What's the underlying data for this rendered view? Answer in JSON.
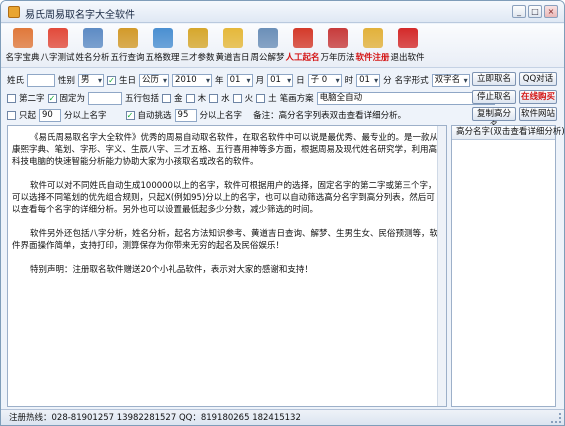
{
  "window": {
    "title": "易氏周易取名字大全软件"
  },
  "toolbar": [
    {
      "label": "名字宝典",
      "icon": "gift-icon",
      "color": "#e0783a"
    },
    {
      "label": "八字测试",
      "icon": "lifebuoy-icon",
      "color": "#e24a3a"
    },
    {
      "label": "姓名分析",
      "icon": "clipboard-icon",
      "color": "#5d8bc4"
    },
    {
      "label": "五行查询",
      "icon": "magnifier-icon",
      "color": "#d29a2a"
    },
    {
      "label": "五格数理",
      "icon": "chart-icon",
      "color": "#4a8fd1"
    },
    {
      "label": "三才参数",
      "icon": "bars-icon",
      "color": "#d6a72c"
    },
    {
      "label": "黄道吉日",
      "icon": "clock-icon",
      "color": "#e5b83a"
    },
    {
      "label": "周公解梦",
      "icon": "monitor-icon",
      "color": "#6b8fb8"
    },
    {
      "label": "人工起名",
      "icon": "house-icon",
      "color": "#d43a2a",
      "red": true
    },
    {
      "label": "万年历法",
      "icon": "flag-icon",
      "color": "#c73b3b"
    },
    {
      "label": "软件注册",
      "icon": "lock-icon",
      "color": "#e2b13a",
      "red": true
    },
    {
      "label": "退出软件",
      "icon": "stop-icon",
      "color": "#d42a2a"
    }
  ],
  "form": {
    "surname_label": "姓氏",
    "gender_label": "性别",
    "gender_value": "男",
    "birthday_label": "生日",
    "calendar_value": "公历",
    "year_value": "2010",
    "year_unit": "年",
    "month_value": "01",
    "month_unit": "月",
    "day_value": "01",
    "day_unit": "日",
    "hour_prefix": "子 0",
    "hour_unit": "时",
    "hour_value": "01",
    "minute_unit": "分",
    "name_form_label": "名字形式",
    "name_form_value": "双字名",
    "fixed_char_label": "第二字",
    "fixed_label": "固定为",
    "wuxing_label": "五行包括",
    "wuxing_options": [
      "金",
      "木",
      "水",
      "火",
      "土"
    ],
    "scheme_label": "笔画方案",
    "scheme_value": "电脑全自动",
    "only_label": "只起",
    "only_value": "90",
    "above_label": "分以上名字",
    "autoselect_label": "自动挑选",
    "autoselect_value": "95",
    "autoselect_suffix": "分以上名字",
    "note": "备注：高分名字列表双击查看详细分析。"
  },
  "buttons": {
    "start": "立即取名",
    "qq": "QQ对话",
    "stop": "停止取名",
    "buy": "在线购买",
    "copy": "复制高分名",
    "website": "软件网站"
  },
  "content": {
    "paragraphs": [
      "《易氏周易取名字大全软件》优秀的周易自动取名软件，在取名软件中可以说是最优秀、最专业的。是一款从康熙字典、笔划、字形、字义、生辰八字、三才五格、五行喜用神等多方面，根据周易及现代姓名研究学，利用高科技电脑的快速智能分析能力协助大家为小孩取名或改名的软件。",
      "软件可以对不同姓氏自动生成100000以上的名字，软件可根据用户的选择，固定名字的第二字或第三个字，可以选择不同笔划的优先组合规则，只起X(例如95)分以上的名字，也可以自动筛选高分名字到高分列表，然后可以查看每个名字的详细分析。另外也可以设置最低起多少分数，减少筛选的时间。",
      "软件另外还包括八字分析，姓名分析，起名方法知识参考、黄道吉日查询、解梦、生男生女、民俗预测等，软件界面操作简单，支持打印，测算保存为你带来无穷的起名及民俗娱乐！",
      "特别声明：注册取名软件赠送20个小礼品软件，表示对大家的感谢和支持！"
    ]
  },
  "side_panel": {
    "header": "高分名字(双击查看详细分析)"
  },
  "status": {
    "text": "注册热线：028-81901257 13982281527 QQ：819180265 182415132"
  }
}
